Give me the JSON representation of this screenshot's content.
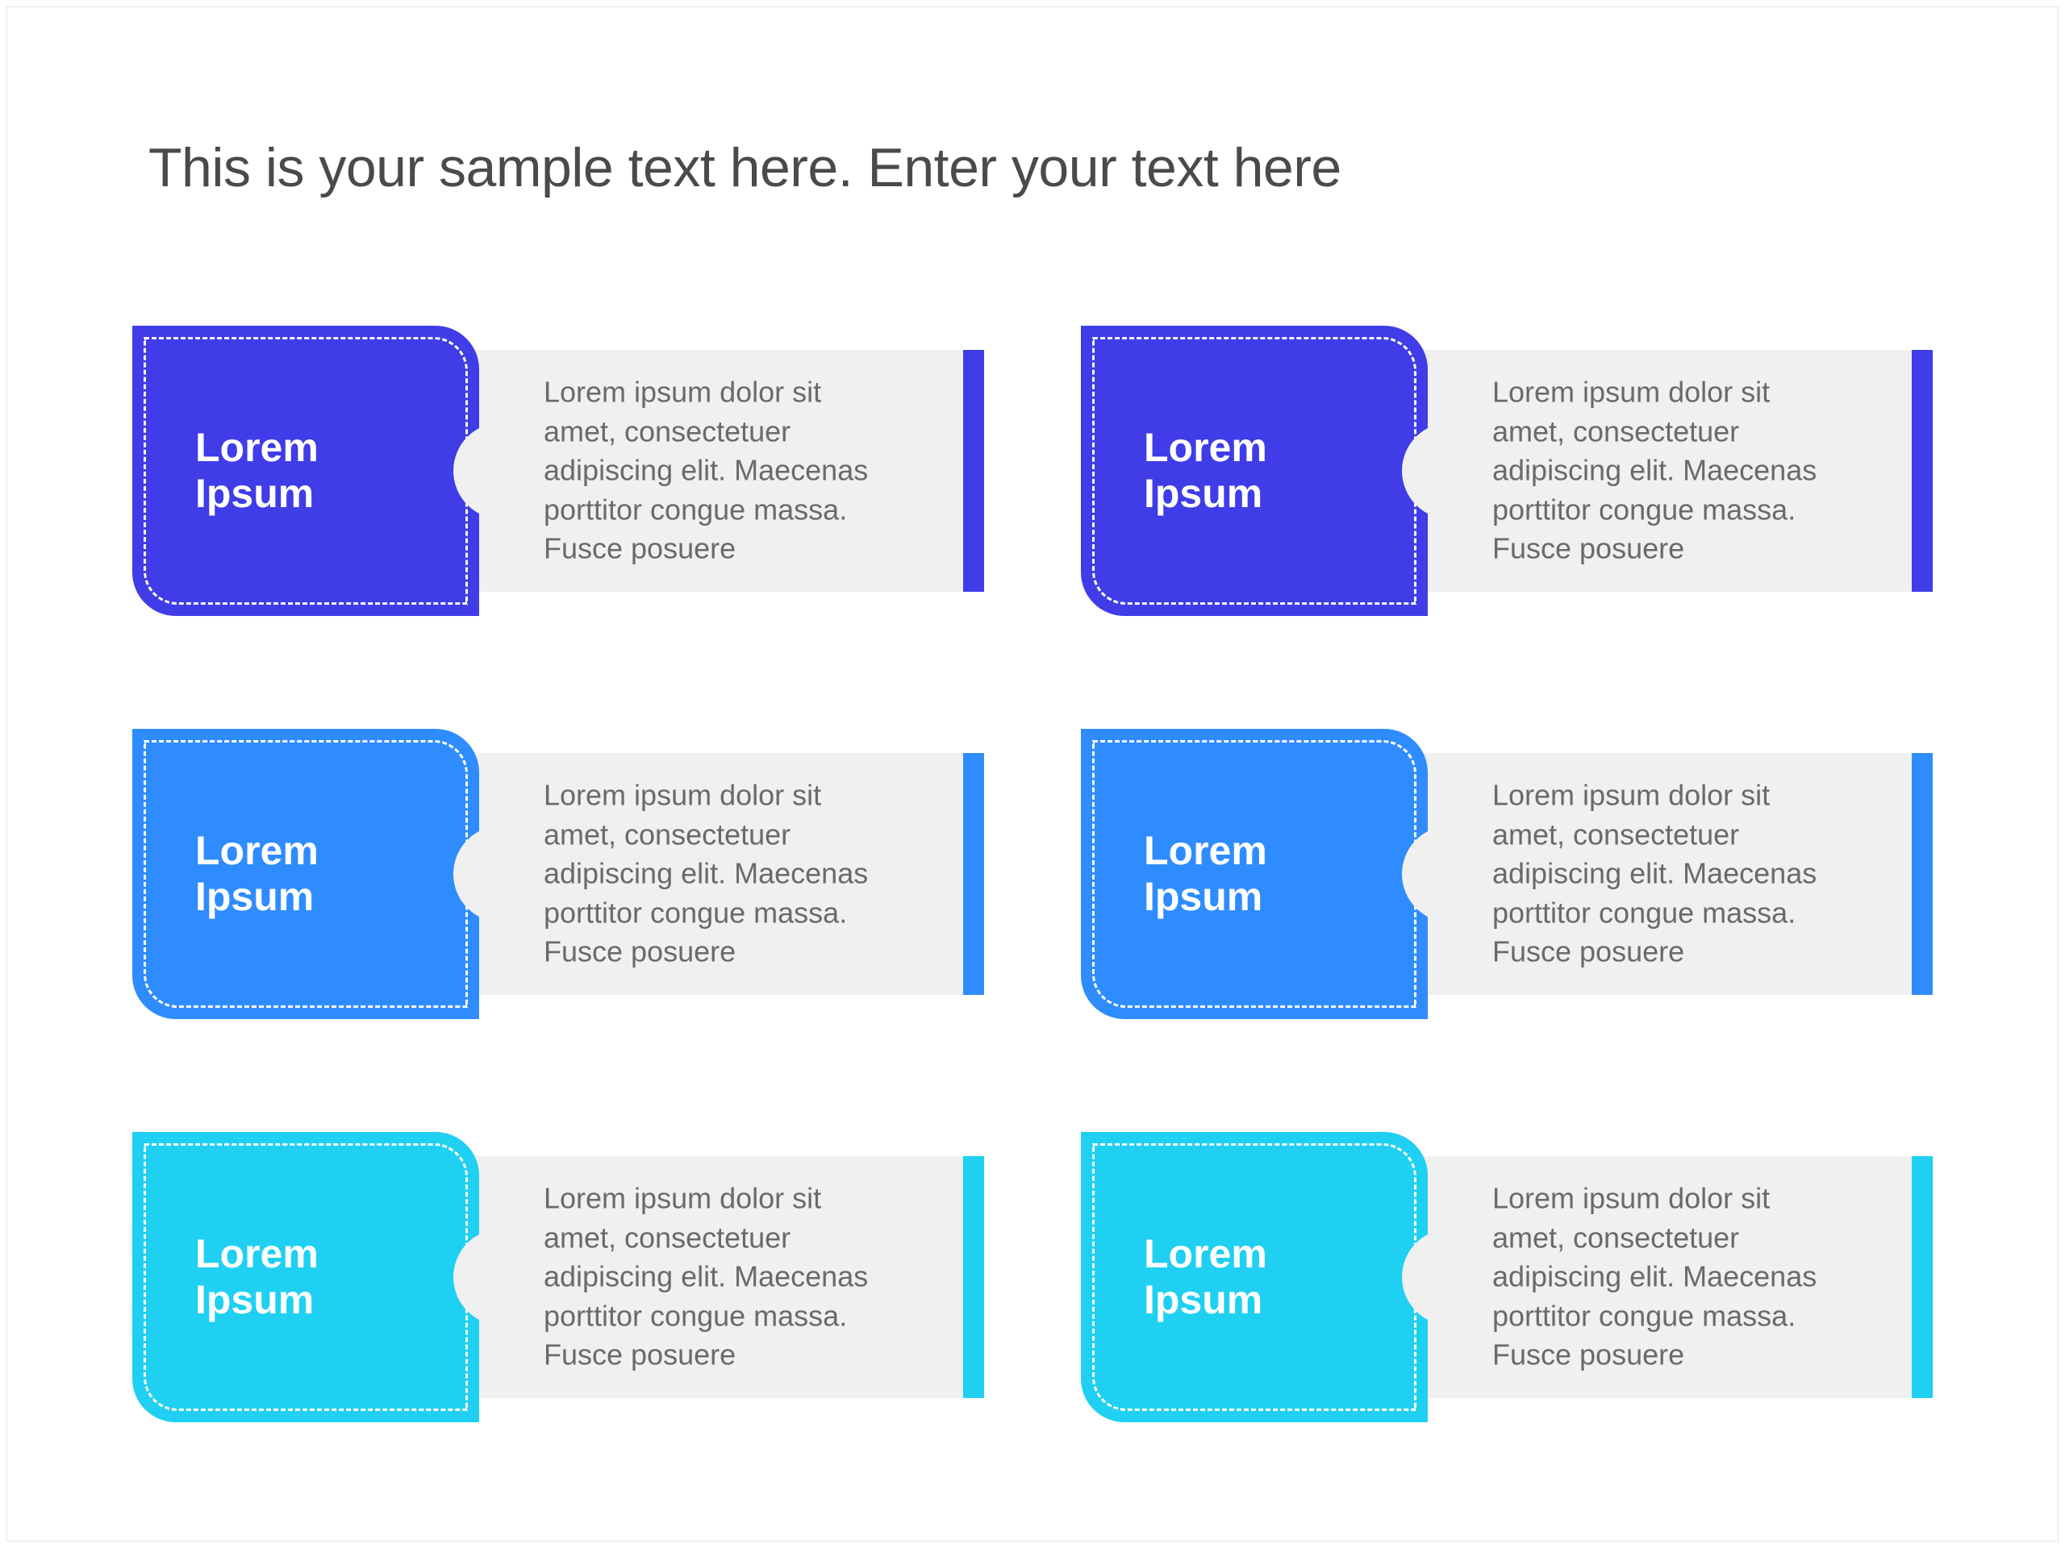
{
  "heading": "This is your sample text here. Enter your text here",
  "colors": {
    "row1": "#3f3ce8",
    "row2": "#2f8cff",
    "row3": "#1fd0f2"
  },
  "cards": [
    {
      "title": "Lorem\nIpsum",
      "body": "Lorem ipsum dolor sit amet, consectetuer adipiscing elit. Maecenas porttitor congue massa. Fusce posuere",
      "colorKey": "row1"
    },
    {
      "title": "Lorem\nIpsum",
      "body": "Lorem ipsum dolor sit amet, consectetuer adipiscing elit. Maecenas porttitor congue massa. Fusce posuere",
      "colorKey": "row1"
    },
    {
      "title": "Lorem\nIpsum",
      "body": "Lorem ipsum dolor sit amet, consectetuer adipiscing elit. Maecenas porttitor congue massa. Fusce posuere",
      "colorKey": "row2"
    },
    {
      "title": "Lorem\nIpsum",
      "body": "Lorem ipsum dolor sit amet, consectetuer adipiscing elit. Maecenas porttitor congue massa. Fusce posuere",
      "colorKey": "row2"
    },
    {
      "title": "Lorem\nIpsum",
      "body": "Lorem ipsum dolor sit amet, consectetuer adipiscing elit. Maecenas porttitor congue massa. Fusce posuere",
      "colorKey": "row3"
    },
    {
      "title": "Lorem\nIpsum",
      "body": "Lorem ipsum dolor sit amet, consectetuer adipiscing elit. Maecenas porttitor congue massa. Fusce posuere",
      "colorKey": "row3"
    }
  ]
}
